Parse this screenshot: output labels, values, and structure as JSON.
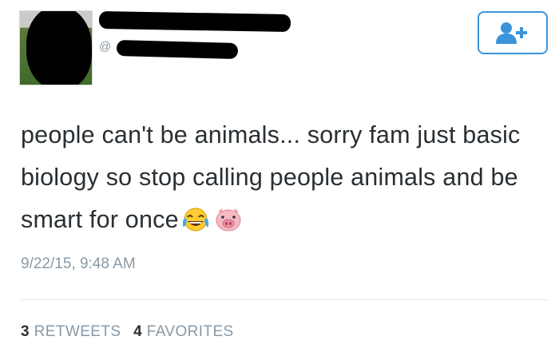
{
  "user": {
    "handle_prefix": "@"
  },
  "tweet": {
    "text": "people can't be animals... sorry fam just basic biology so stop calling people animals and be smart for once",
    "emojis": [
      "face-with-tears-of-joy-emoji",
      "pig-face-emoji"
    ],
    "timestamp": "9/22/15, 9:48 AM"
  },
  "stats": {
    "retweets_count": "3",
    "retweets_label": "RETWEETS",
    "favorites_count": "4",
    "favorites_label": "FAVORITES"
  },
  "colors": {
    "accent": "#3b94d9",
    "text": "#292f33",
    "muted": "#8899a6"
  },
  "icons": {
    "follow": "add-user-icon"
  }
}
